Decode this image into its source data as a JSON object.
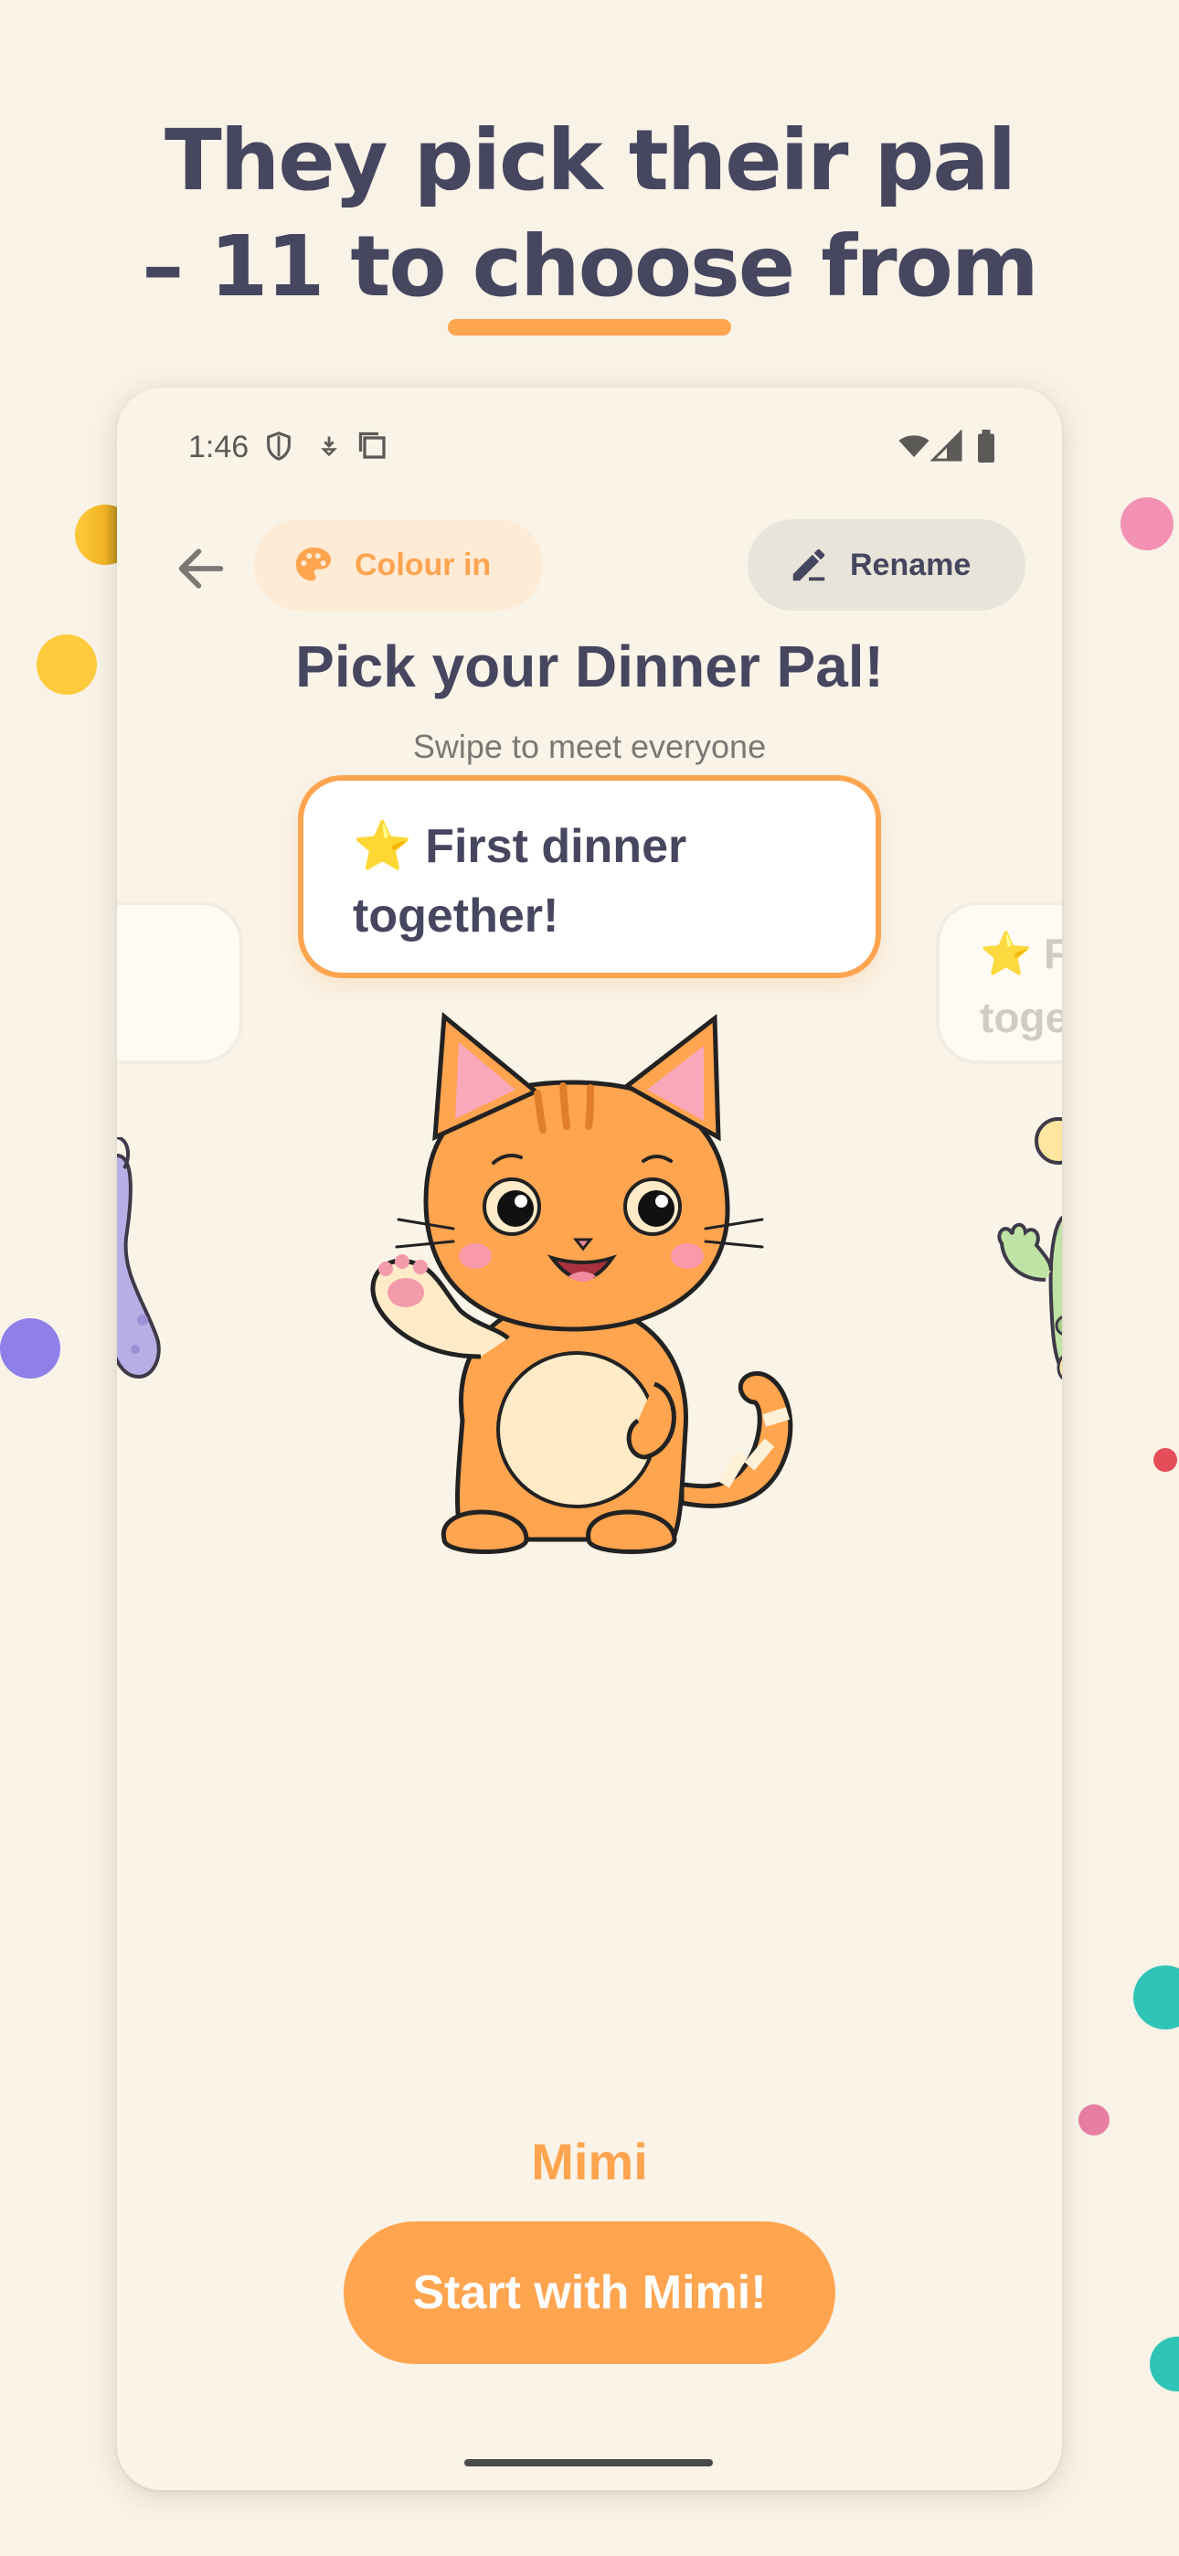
{
  "headline": {
    "line1": "They pick their pal",
    "line2": "– 11 to choose from"
  },
  "status_bar": {
    "time": "1:46"
  },
  "top_bar": {
    "colour_label": "Colour in",
    "rename_label": "Rename"
  },
  "screen": {
    "title": "Pick your Dinner Pal!",
    "subtitle": "Swipe to meet everyone",
    "bubble_emoji": "⭐",
    "bubble_line1": "First dinner",
    "bubble_line2": "together!",
    "side_card_line1": "⭐ F",
    "side_card_line2": "toge",
    "pal_name": "Mimi",
    "cta_label": "Start with Mimi!"
  },
  "colors": {
    "background": "#F8F2E7",
    "accent_orange": "#FFA44F",
    "text_dark": "#46465F",
    "chip_orange_bg": "#FDEBD6",
    "chip_gray_bg": "#E9E4DA"
  },
  "icons": {
    "back": "arrow-left-icon",
    "palette": "palette-icon",
    "rename": "pencil-icon",
    "wifi": "wifi-icon",
    "signal": "signal-icon",
    "battery": "battery-icon"
  }
}
